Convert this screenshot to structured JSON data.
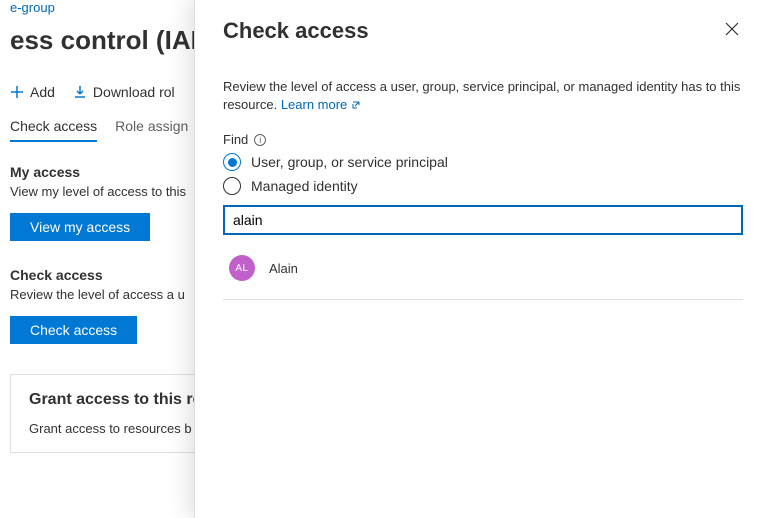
{
  "breadcrumb": "e-group",
  "page_title_partial": "ess control (IAM)",
  "toolbar": {
    "add": "Add",
    "download": "Download rol"
  },
  "tabs": {
    "check_access": "Check access",
    "role_assign": "Role assign"
  },
  "my_access": {
    "heading": "My access",
    "desc": "View my level of access to this",
    "button": "View my access"
  },
  "check_access_section": {
    "heading": "Check access",
    "desc": "Review the level of access a u",
    "button": "Check access"
  },
  "grant_tile": {
    "title": "Grant access to this re",
    "desc": "Grant access to resources b"
  },
  "panel": {
    "title": "Check access",
    "desc_prefix": "Review the level of access a user, group, service principal, or managed identity has to this resource. ",
    "learn_more": "Learn more",
    "find_label": "Find",
    "radio_user": "User, group, or service principal",
    "radio_managed": "Managed identity",
    "search_value": "alain",
    "result": {
      "initials": "AL",
      "name": "Alain"
    }
  }
}
